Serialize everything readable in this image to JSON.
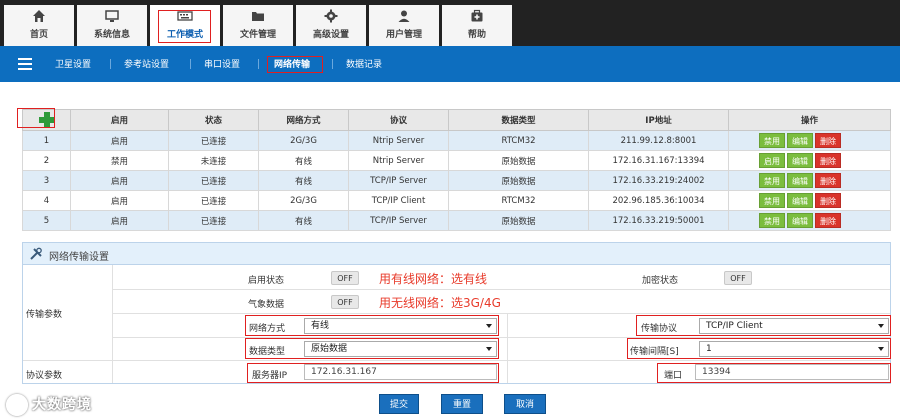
{
  "top_tabs": [
    {
      "label": "首页",
      "icon": "home-icon"
    },
    {
      "label": "系统信息",
      "icon": "monitor-icon"
    },
    {
      "label": "工作模式",
      "icon": "keyboard-icon"
    },
    {
      "label": "文件管理",
      "icon": "folder-icon"
    },
    {
      "label": "高级设置",
      "icon": "gear-icon"
    },
    {
      "label": "用户管理",
      "icon": "user-icon"
    },
    {
      "label": "帮助",
      "icon": "help-icon"
    }
  ],
  "sub_nav": [
    "卫星设置",
    "参考站设置",
    "串口设置",
    "网络传输",
    "数据记录"
  ],
  "table": {
    "headers": [
      "启用",
      "状态",
      "网络方式",
      "协议",
      "数据类型",
      "IP地址",
      "操作"
    ],
    "rows": [
      {
        "no": "1",
        "enabled": "启用",
        "status": "已连接",
        "net": "2G/3G",
        "protocol": "Ntrip Server",
        "dtype": "RTCM32",
        "ip": "211.99.12.8:8001"
      },
      {
        "no": "2",
        "enabled": "禁用",
        "status": "未连接",
        "net": "有线",
        "protocol": "Ntrip Server",
        "dtype": "原始数据",
        "ip": "172.16.31.167:13394"
      },
      {
        "no": "3",
        "enabled": "启用",
        "status": "已连接",
        "net": "有线",
        "protocol": "TCP/IP Server",
        "dtype": "原始数据",
        "ip": "172.16.33.219:24002"
      },
      {
        "no": "4",
        "enabled": "启用",
        "status": "已连接",
        "net": "2G/3G",
        "protocol": "TCP/IP Client",
        "dtype": "RTCM32",
        "ip": "202.96.185.36:10034"
      },
      {
        "no": "5",
        "enabled": "启用",
        "status": "已连接",
        "net": "有线",
        "protocol": "TCP/IP Server",
        "dtype": "原始数据",
        "ip": "172.16.33.219:50001"
      }
    ],
    "row_actions": [
      "禁用",
      "编辑",
      "删除"
    ],
    "row2_actions": [
      "启用",
      "编辑",
      "删除"
    ]
  },
  "panel": {
    "title": "网络传输设置",
    "group_transfer": "传输参数",
    "group_protocol": "协议参数",
    "enable_label": "启用状态",
    "enable_value": "OFF",
    "weather_label": "气象数据",
    "weather_value": "OFF",
    "encrypt_label": "加密状态",
    "encrypt_value": "OFF",
    "net_label": "网络方式",
    "net_value": "有线",
    "dtype_label": "数据类型",
    "dtype_value": "原始数据",
    "protocol_label": "传输协议",
    "protocol_value": "TCP/IP Client",
    "interval_label": "传输间隔[S]",
    "interval_value": "1",
    "server_label": "服务器IP",
    "server_value": "172.16.31.167",
    "port_label": "端口",
    "port_value": "13394",
    "annot_wired": "用有线网络：选有线",
    "annot_wireless": "用无线网络：选3G/4G"
  },
  "buttons": {
    "submit": "提交",
    "reset": "重置",
    "cancel": "取消"
  },
  "watermark": "大数跨境",
  "colors": {
    "topbar": "#222222",
    "subnav": "#0d6ebf",
    "accent_red": "#e02020",
    "green_btn": "#7bbd3e",
    "red_btn": "#d9342b",
    "row_alt": "#dfecf7"
  }
}
